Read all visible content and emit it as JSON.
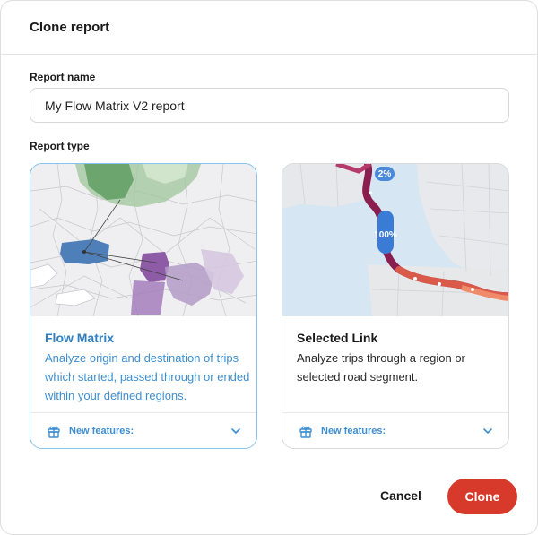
{
  "dialog": {
    "title": "Clone report",
    "report_name_label": "Report name",
    "report_type_label": "Report type"
  },
  "report_name": {
    "value": "My Flow Matrix V2 report"
  },
  "report_types": [
    {
      "title": "Flow Matrix",
      "description": "Analyze origin and destination of trips which started, passed through or ended within your defined regions.",
      "new_features_label": "New features:",
      "selected": true,
      "gift_icon": "gift-icon",
      "chevron_icon": "chevron-down-icon"
    },
    {
      "title": "Selected Link",
      "description": "Analyze trips through a region or selected road segment.",
      "new_features_label": "New features:",
      "selected": false,
      "gift_icon": "gift-icon",
      "chevron_icon": "chevron-down-icon",
      "map_labels": {
        "top": "2%",
        "middle": "100%"
      }
    }
  ],
  "actions": {
    "cancel_label": "Cancel",
    "clone_label": "Clone"
  },
  "colors": {
    "accent_blue": "#3f8fd0",
    "selected_border": "#86c3ee",
    "clone_button": "#d73a2a"
  }
}
